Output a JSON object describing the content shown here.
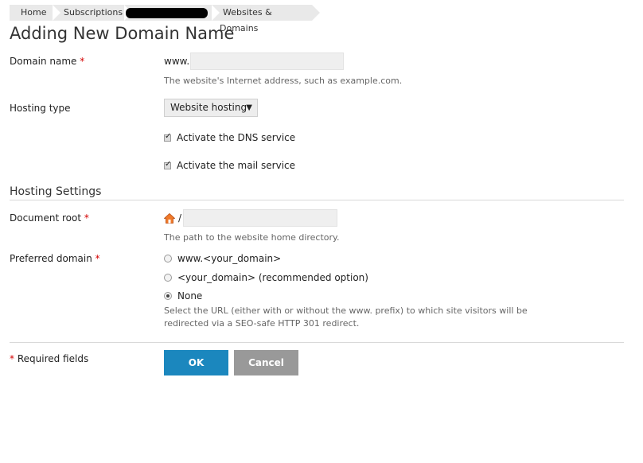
{
  "breadcrumb": {
    "home": "Home",
    "subscriptions": "Subscriptions",
    "websites_domains": "Websites & Domains"
  },
  "page_title": "Adding New Domain Name",
  "domain_name": {
    "label": "Domain name",
    "required_mark": "*",
    "prefix": "www.",
    "value": "",
    "hint": "The website's Internet address, such as example.com."
  },
  "hosting_type": {
    "label": "Hosting type",
    "selected": "Website hosting"
  },
  "dns_service": {
    "label": "Activate the DNS service",
    "checked": true
  },
  "mail_service": {
    "label": "Activate the mail service",
    "checked": true
  },
  "hosting_settings": {
    "title": "Hosting Settings",
    "document_root": {
      "label": "Document root",
      "required_mark": "*",
      "slash": "/",
      "value": "",
      "hint": "The path to the website home directory."
    },
    "preferred_domain": {
      "label": "Preferred domain",
      "required_mark": "*",
      "options": [
        {
          "label": "www.<your_domain>",
          "selected": false
        },
        {
          "label": "<your_domain> (recommended option)",
          "selected": false
        },
        {
          "label": "None",
          "selected": true
        }
      ],
      "hint_line1": "Select the URL (either with or without the www. prefix) to which site visitors will be",
      "hint_line2": "redirected via a SEO-safe HTTP 301 redirect."
    }
  },
  "footer": {
    "required_mark": "*",
    "required_text": "Required fields",
    "ok_label": "OK",
    "cancel_label": "Cancel"
  },
  "colors": {
    "ok_button": "#1b87be",
    "cancel_button": "#999999",
    "required": "#d40000"
  }
}
